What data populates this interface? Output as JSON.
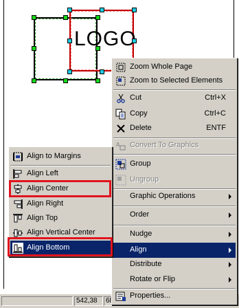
{
  "canvas": {
    "logo_text": "LOGO"
  },
  "status_bar": {
    "coordinates": "542,38",
    "zoom_partial": "68"
  },
  "context_menu": {
    "items": [
      {
        "label": "Zoom Whole Page",
        "icon": "zoom-page-icon"
      },
      {
        "label": "Zoom to Selected Elements",
        "icon": "zoom-selection-icon"
      },
      {
        "label": "Cut",
        "shortcut": "Ctrl+X",
        "icon": "scissors-icon"
      },
      {
        "label": "Copy",
        "shortcut": "Ctrl+C",
        "icon": "copy-icon"
      },
      {
        "label": "Delete",
        "shortcut": "ENTF",
        "icon": "delete-x-icon"
      },
      {
        "label": "Convert To Graphics",
        "disabled": true,
        "icon": "convert-graphics-icon"
      },
      {
        "label": "Group",
        "icon": "group-icon"
      },
      {
        "label": "Ungroup",
        "disabled": true,
        "icon": "ungroup-icon"
      },
      {
        "label": "Graphic Operations",
        "submenu": true
      },
      {
        "label": "Order",
        "submenu": true
      },
      {
        "label": "Nudge",
        "submenu": true
      },
      {
        "label": "Align",
        "submenu": true,
        "selected": true
      },
      {
        "label": "Distribute",
        "submenu": true
      },
      {
        "label": "Rotate or Flip",
        "submenu": true
      },
      {
        "label": "Properties...",
        "icon": "properties-icon"
      }
    ]
  },
  "align_submenu": {
    "items": [
      {
        "label": "Align to Margins",
        "icon": "align-margins-icon"
      },
      {
        "label": "Align Left",
        "icon": "align-left-icon"
      },
      {
        "label": "Align Center",
        "icon": "align-center-icon",
        "highlighted_box": true
      },
      {
        "label": "Align Right",
        "icon": "align-right-icon"
      },
      {
        "label": "Align Top",
        "icon": "align-top-icon"
      },
      {
        "label": "Align Vertical Center",
        "icon": "align-vertical-center-icon"
      },
      {
        "label": "Align Bottom",
        "icon": "align-bottom-icon",
        "selected": true,
        "highlighted_box": true
      }
    ]
  },
  "colors": {
    "menu_bg": "#d4d0c8",
    "selection_bg": "#0a246a",
    "annotation_red": "#e0141e",
    "handle_green": "#19d719",
    "handle_cyan": "#1ecbe1"
  }
}
